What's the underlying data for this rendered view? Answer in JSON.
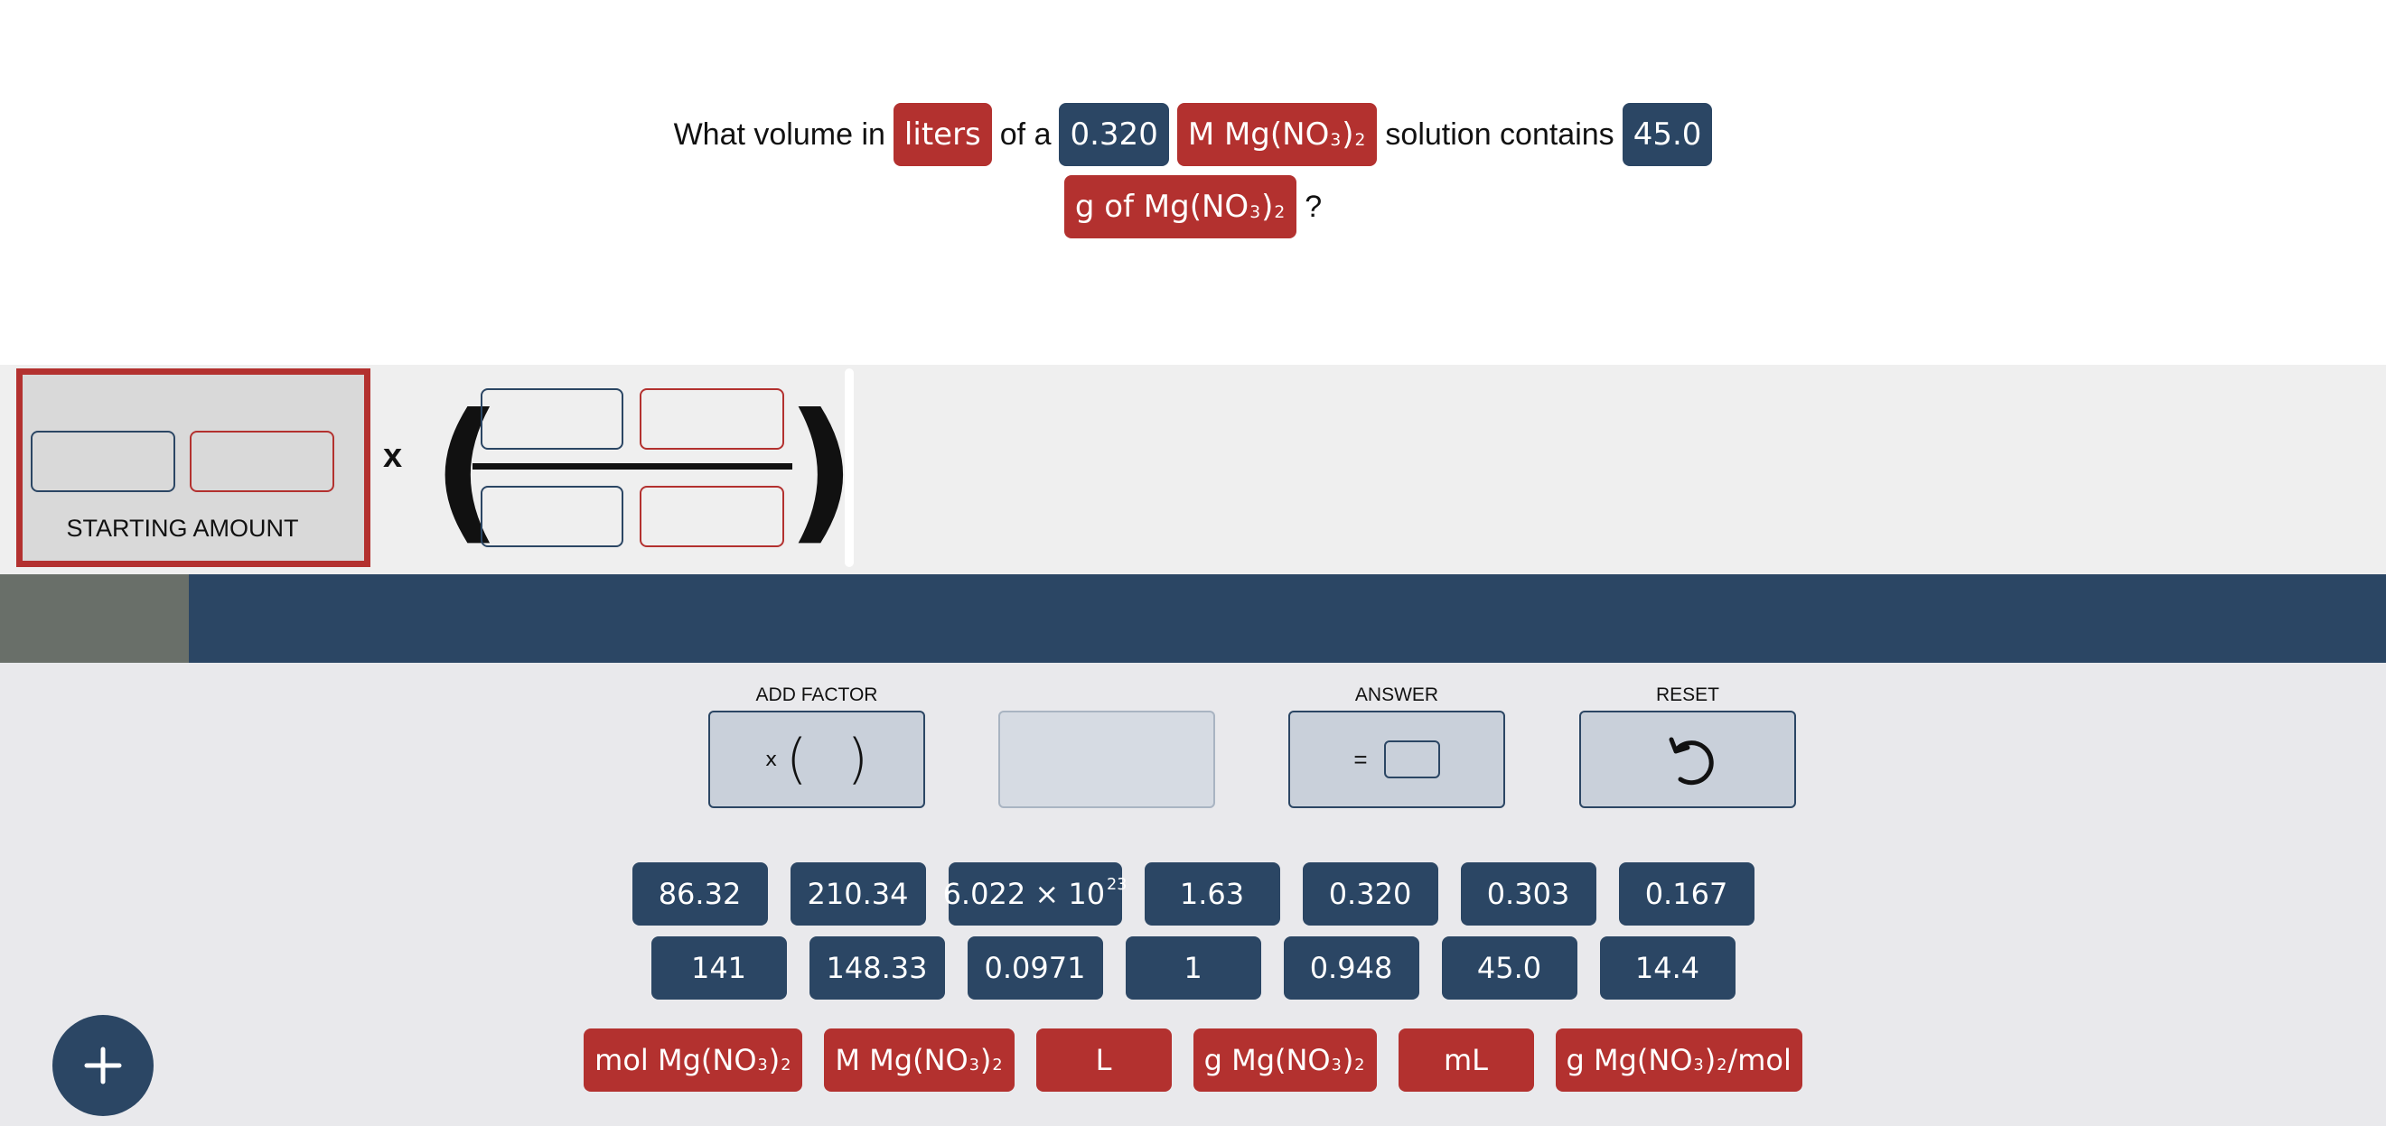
{
  "question": {
    "line1": [
      {
        "kind": "text",
        "text": "What volume in"
      },
      {
        "kind": "chip",
        "color": "red",
        "text": "liters"
      },
      {
        "kind": "text",
        "text": "of a"
      },
      {
        "kind": "chip",
        "color": "navy",
        "text": "0.320"
      },
      {
        "kind": "chip",
        "color": "red",
        "text": "M Mg(NO",
        "sub1": "3",
        "close": ")",
        "sub2": "2",
        "tail": ""
      },
      {
        "kind": "text",
        "text": "solution contains"
      },
      {
        "kind": "chip",
        "color": "navy",
        "text": "45.0"
      }
    ],
    "line2": [
      {
        "kind": "chip",
        "color": "red",
        "text": "g of Mg(NO",
        "sub1": "3",
        "close": ")",
        "sub2": "2",
        "tail": ""
      },
      {
        "kind": "text",
        "text": "?"
      }
    ]
  },
  "setup": {
    "starting_amount_label": "STARTING AMOUNT",
    "times_sign": "x"
  },
  "progress": {
    "fraction": 0.079
  },
  "tools": {
    "add_factor": {
      "label": "ADD FACTOR",
      "symbol": "x"
    },
    "answer": {
      "label": "ANSWER",
      "symbol": "="
    },
    "reset": {
      "label": "RESET"
    }
  },
  "numbers": {
    "row1": [
      "86.32",
      "210.34",
      "6.022 × 10",
      "1.63",
      "0.320",
      "0.303",
      "0.167"
    ],
    "row2": [
      "141",
      "148.33",
      "0.0971",
      "1",
      "0.948",
      "45.0",
      "14.4"
    ],
    "avogadro_exp": "23"
  },
  "units": [
    {
      "text": "mol Mg(NO",
      "sub1": "3",
      "close": ")",
      "sub2": "2",
      "tail": ""
    },
    {
      "text": "M Mg(NO",
      "sub1": "3",
      "close": ")",
      "sub2": "2",
      "tail": ""
    },
    {
      "text": "L"
    },
    {
      "text": "g Mg(NO",
      "sub1": "3",
      "close": ")",
      "sub2": "2",
      "tail": ""
    },
    {
      "text": "mL"
    },
    {
      "text": "g Mg(NO",
      "sub1": "3",
      "close": ")",
      "sub2": "2",
      "tail": "/mol"
    }
  ],
  "colors": {
    "navy": "#2b4664",
    "red": "#b3312f",
    "progress_fill": "#696f69"
  },
  "icons": {
    "reset": "undo-arrow-icon",
    "fab": "plus-icon"
  }
}
